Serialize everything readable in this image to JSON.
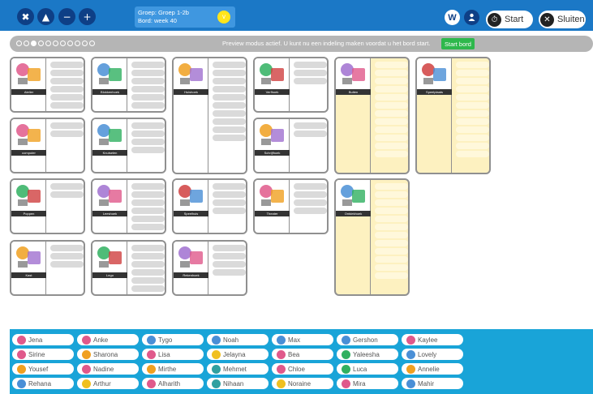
{
  "topbar": {
    "tools": [
      {
        "icon": "crossed-tools-icon",
        "glyph": "✖"
      },
      {
        "icon": "landscape-icon",
        "glyph": "▲"
      },
      {
        "icon": "zoom-out-icon",
        "glyph": "−"
      },
      {
        "icon": "zoom-in-icon",
        "glyph": "+"
      }
    ],
    "group_line": "Groep: Groep 1-2b",
    "board_line": "Bord: week 40",
    "settings_glyph": "v",
    "w_label": "W",
    "person_label": "",
    "start_label": "Start",
    "close_label": "Sluiten",
    "colors": {
      "bar": "#1b78c6",
      "dark_button": "#0e3f86",
      "yellow": "#ffe51c"
    }
  },
  "preview": {
    "dots_total": 11,
    "dots_active_index": 2,
    "message": "Preview modus actief. U kunt nu een indeling maken voordat u het bord start.",
    "start_board_label": "Start bord",
    "accent": "#2eb84c"
  },
  "cards": [
    {
      "label": "Atelier",
      "slots": 6,
      "style": "white",
      "icon": "atelier-icon"
    },
    {
      "label": "Blokkenhoek",
      "slots": 6,
      "style": "white",
      "icon": "blocks-icon"
    },
    {
      "label": "Huishoek",
      "slots": 10,
      "style": "white",
      "icon": "house-corner-icon"
    },
    {
      "label": "Verfhoek",
      "slots": 3,
      "style": "white",
      "icon": "paint-icon"
    },
    {
      "label": "Buiten",
      "slots": 12,
      "style": "yellow",
      "icon": "outdoor-icon"
    },
    {
      "label": "Speelplaats",
      "slots": 12,
      "style": "yellow",
      "icon": "playground-icon"
    },
    {
      "label": "computer",
      "slots": 2,
      "style": "white",
      "icon": "computer-icon"
    },
    {
      "label": "Knutselen",
      "slots": 4,
      "style": "white",
      "icon": "crafts-icon"
    },
    {
      "label": "Schrijfhoek",
      "slots": 2,
      "style": "white",
      "icon": "writing-icon"
    },
    {
      "label": "Poppen",
      "slots": 2,
      "style": "white",
      "icon": "puppet-icon"
    },
    {
      "label": "Leeshoek",
      "slots": 6,
      "style": "white",
      "icon": "reading-icon"
    },
    {
      "label": "Speelhuis",
      "slots": 4,
      "style": "white",
      "icon": "toy-house-icon"
    },
    {
      "label": "Theater",
      "slots": 4,
      "style": "white",
      "icon": "theater-icon"
    },
    {
      "label": "Ontdekhoek",
      "slots": 12,
      "style": "yellow",
      "icon": "discover-icon"
    },
    {
      "label": "Kast",
      "slots": 3,
      "style": "white",
      "icon": "cabinet-icon"
    },
    {
      "label": "Lego",
      "slots": 6,
      "style": "white",
      "icon": "lego-icon"
    },
    {
      "label": "Rekenhoek",
      "slots": 4,
      "style": "white",
      "icon": "math-icon"
    }
  ],
  "kids": [
    {
      "name": "Jena",
      "color": "#e0598b"
    },
    {
      "name": "Anke",
      "color": "#e0598b"
    },
    {
      "name": "Tygo",
      "color": "#4a8fd6"
    },
    {
      "name": "Noah",
      "color": "#4a8fd6"
    },
    {
      "name": "Max",
      "color": "#4a8fd6"
    },
    {
      "name": "Gershon",
      "color": "#4a8fd6"
    },
    {
      "name": "Kaylee",
      "color": "#e0598b"
    },
    {
      "name": "Sirine",
      "color": "#e0598b"
    },
    {
      "name": "Sharona",
      "color": "#f0a020"
    },
    {
      "name": "Lisa",
      "color": "#e0598b"
    },
    {
      "name": "Jelayna",
      "color": "#f0c020"
    },
    {
      "name": "Bea",
      "color": "#e0598b"
    },
    {
      "name": "Yaleesha",
      "color": "#30b060"
    },
    {
      "name": "Lovely",
      "color": "#4a8fd6"
    },
    {
      "name": "Yousef",
      "color": "#f0a020"
    },
    {
      "name": "Nadine",
      "color": "#e0598b"
    },
    {
      "name": "Mirthe",
      "color": "#f0a020"
    },
    {
      "name": "Mehmet",
      "color": "#30a0a0"
    },
    {
      "name": "Chloe",
      "color": "#e0598b"
    },
    {
      "name": "Luca",
      "color": "#30b060"
    },
    {
      "name": "Annelie",
      "color": "#f0a020"
    },
    {
      "name": "Rehana",
      "color": "#4a8fd6"
    },
    {
      "name": "Arthur",
      "color": "#f0c020"
    },
    {
      "name": "Alharith",
      "color": "#e0598b"
    },
    {
      "name": "Nihaan",
      "color": "#30a0a0"
    },
    {
      "name": "Noraine",
      "color": "#f0c020"
    },
    {
      "name": "Mira",
      "color": "#e0598b"
    },
    {
      "name": "Mahir",
      "color": "#4a8fd6"
    }
  ]
}
